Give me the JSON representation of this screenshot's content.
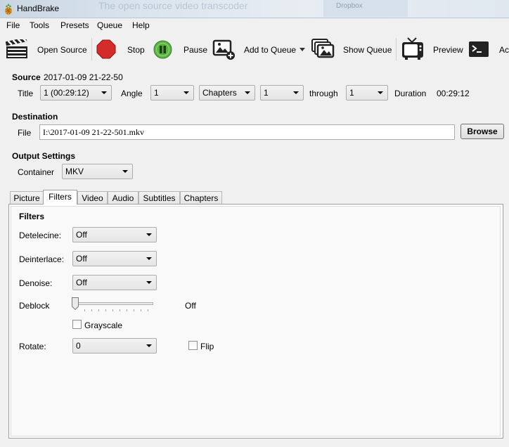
{
  "window": {
    "title": "HandBrake",
    "bg_text": "The open source video transcoder",
    "bg_item": "Dropbox"
  },
  "menu": [
    "File",
    "Tools",
    "Presets",
    "Queue",
    "Help"
  ],
  "toolbar": {
    "open_source": "Open Source",
    "stop": "Stop",
    "pause": "Pause",
    "add_to_queue": "Add to Queue",
    "show_queue": "Show Queue",
    "preview": "Preview",
    "activity": "Ac"
  },
  "source": {
    "label": "Source",
    "value": "2017-01-09 21-22-50",
    "title_label": "Title",
    "title_value": "1 (00:29:12)",
    "angle_label": "Angle",
    "angle_value": "1",
    "range_mode": "Chapters",
    "range_start": "1",
    "through_label": "through",
    "range_end": "1",
    "duration_label": "Duration",
    "duration_value": "00:29:12"
  },
  "destination": {
    "label": "Destination",
    "file_label": "File",
    "file_value": "I:\\2017-01-09 21-22-501.mkv",
    "browse": "Browse"
  },
  "output": {
    "label": "Output Settings",
    "container_label": "Container",
    "container_value": "MKV"
  },
  "tabs": [
    "Picture",
    "Filters",
    "Video",
    "Audio",
    "Subtitles",
    "Chapters"
  ],
  "active_tab": "Filters",
  "filters": {
    "heading": "Filters",
    "detelecine_label": "Detelecine:",
    "detelecine_value": "Off",
    "deinterlace_label": "Deinterlace:",
    "deinterlace_value": "Off",
    "denoise_label": "Denoise:",
    "denoise_value": "Off",
    "deblock_label": "Deblock",
    "deblock_value": "Off",
    "deblock_level": 0,
    "grayscale_label": "Grayscale",
    "grayscale_checked": false,
    "rotate_label": "Rotate:",
    "rotate_value": "0",
    "flip_label": "Flip",
    "flip_checked": false
  },
  "colors": {
    "stop": "#d42b2b",
    "pause": "#5bb43f"
  }
}
